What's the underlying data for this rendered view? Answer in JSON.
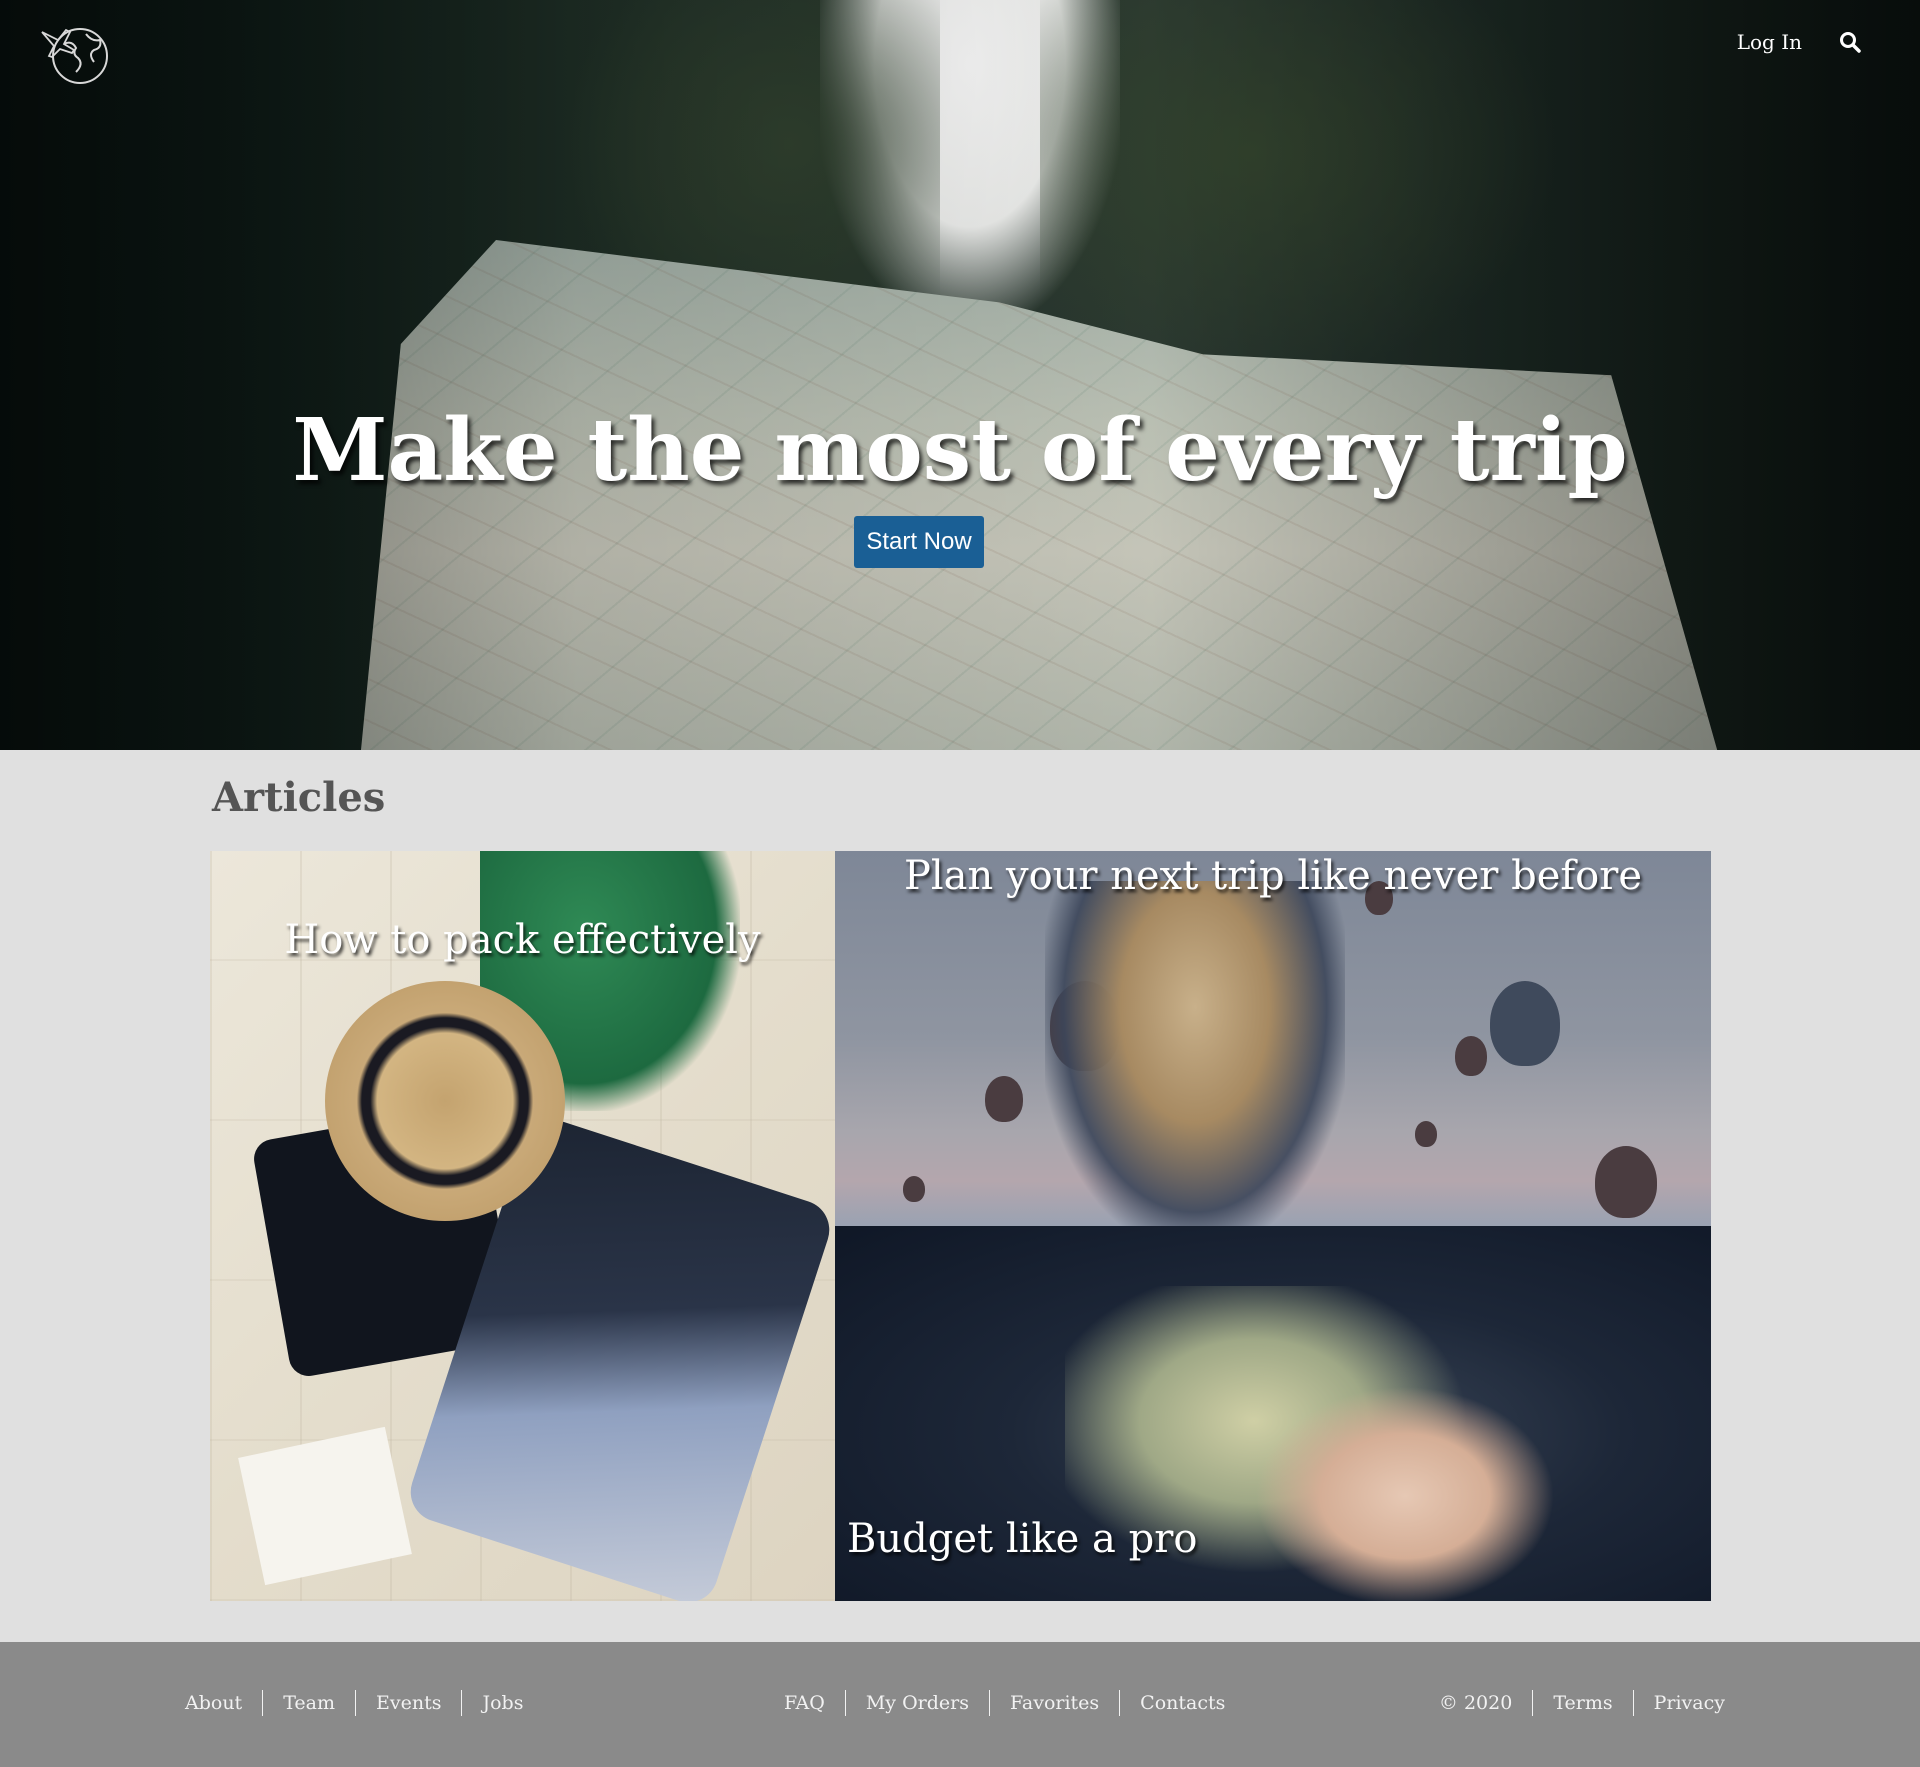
{
  "header": {
    "logo_icon": "globe-plane-icon",
    "login_label": "Log In",
    "search_icon": "search-icon"
  },
  "hero": {
    "title": "Make the most of every trip",
    "cta_label": "Start Now",
    "cta_color": "#1a5f95"
  },
  "articles": {
    "heading": "Articles",
    "items": [
      {
        "title": "How to pack effectively"
      },
      {
        "title": "Plan your next trip like never before"
      },
      {
        "title": "Budget like a pro"
      }
    ]
  },
  "footer": {
    "left_links": [
      "About",
      "Team",
      "Events",
      "Jobs"
    ],
    "center_links": [
      "FAQ",
      "My Orders",
      "Favorites",
      "Contacts"
    ],
    "copyright": "© 2020",
    "right_links": [
      "Terms",
      "Privacy"
    ],
    "background": "#8a8a8a"
  }
}
